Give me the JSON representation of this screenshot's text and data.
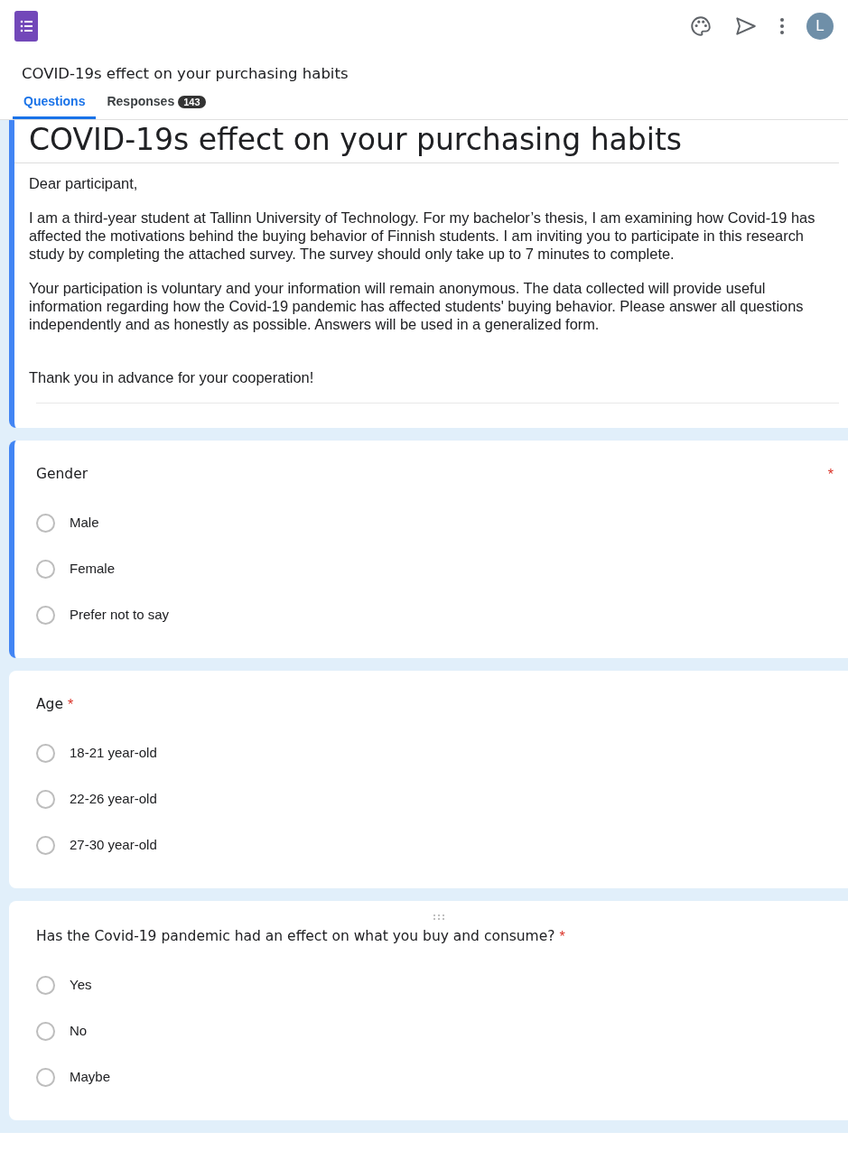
{
  "app": {
    "form_title": "COVID-19s effect on your purchasing habits",
    "avatar_letter": "L"
  },
  "tabs": [
    {
      "label": "Questions",
      "selected": true
    },
    {
      "label": "Responses",
      "selected": false,
      "count": "143"
    }
  ],
  "header": {
    "title": "COVID-19s effect on your purchasing habits",
    "paragraphs": [
      "Dear participant,",
      "I am a third-year student at Tallinn University of Technology. For my bachelor’s thesis, I am examining how Covid-19 has affected the motivations behind the buying behavior of Finnish students. I am inviting you to participate in this research study by completing the attached survey. The survey should only take up to 7 minutes to complete.",
      "Your participation is voluntary and your information will remain anonymous. The data collected will provide useful information regarding how the Covid-19 pandemic has affected students' buying behavior. Please answer all questions independently and  as honestly as possible. Answers will be used in a generalized form.",
      "Thank you in advance for your cooperation!"
    ]
  },
  "questions": [
    {
      "title": "Gender",
      "required": true,
      "required_mark": "*",
      "focused": true,
      "hovered": false,
      "options": [
        {
          "label": "Male",
          "selected": false
        },
        {
          "label": "Female",
          "selected": false
        },
        {
          "label": "Prefer not to say",
          "selected": false
        }
      ]
    },
    {
      "title": "Age",
      "required": true,
      "required_mark": "*",
      "focused": false,
      "hovered": false,
      "options": [
        {
          "label": "18-21 year-old",
          "selected": false
        },
        {
          "label": "22-26 year-old",
          "selected": false
        },
        {
          "label": "27-30 year-old",
          "selected": false
        }
      ]
    },
    {
      "title": "Has the Covid-19 pandemic had an effect on what you buy and consume?",
      "required": true,
      "required_mark": "*",
      "focused": false,
      "hovered": true,
      "options": [
        {
          "label": "Yes",
          "selected": false
        },
        {
          "label": "No",
          "selected": false
        },
        {
          "label": "Maybe",
          "selected": false
        }
      ]
    }
  ]
}
